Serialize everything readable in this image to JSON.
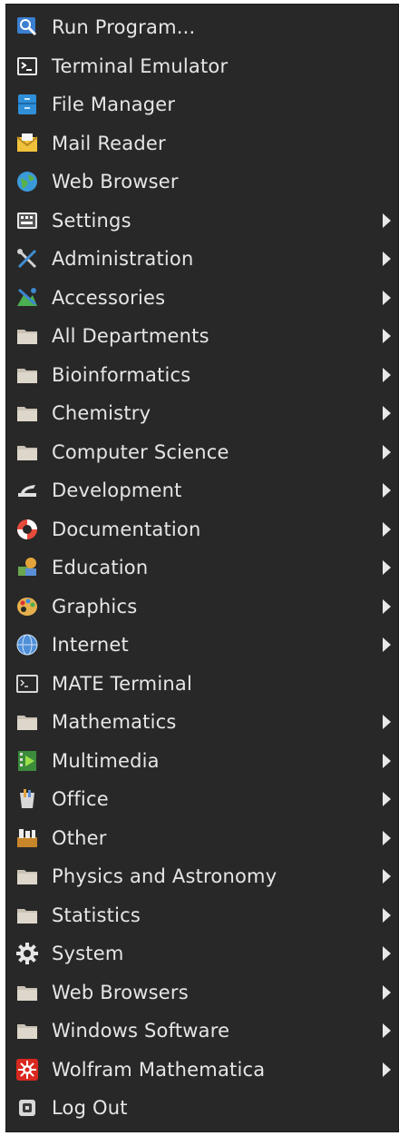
{
  "menu": {
    "items": [
      {
        "label": "Run Program...",
        "icon": "run-program-icon",
        "submenu": false
      },
      {
        "label": "Terminal Emulator",
        "icon": "terminal-icon",
        "submenu": false
      },
      {
        "label": "File Manager",
        "icon": "file-manager-icon",
        "submenu": false
      },
      {
        "label": "Mail Reader",
        "icon": "mail-icon",
        "submenu": false
      },
      {
        "label": "Web Browser",
        "icon": "globe-icon",
        "submenu": false
      },
      {
        "label": "Settings",
        "icon": "settings-icon",
        "submenu": true
      },
      {
        "label": "Administration",
        "icon": "tools-icon",
        "submenu": true
      },
      {
        "label": "Accessories",
        "icon": "accessories-icon",
        "submenu": true
      },
      {
        "label": "All Departments",
        "icon": "folder-icon",
        "submenu": true
      },
      {
        "label": "Bioinformatics",
        "icon": "folder-icon",
        "submenu": true
      },
      {
        "label": "Chemistry",
        "icon": "folder-icon",
        "submenu": true
      },
      {
        "label": "Computer Science",
        "icon": "folder-icon",
        "submenu": true
      },
      {
        "label": "Development",
        "icon": "development-icon",
        "submenu": true
      },
      {
        "label": "Documentation",
        "icon": "lifebuoy-icon",
        "submenu": true
      },
      {
        "label": "Education",
        "icon": "education-icon",
        "submenu": true
      },
      {
        "label": "Graphics",
        "icon": "palette-icon",
        "submenu": true
      },
      {
        "label": "Internet",
        "icon": "internet-icon",
        "submenu": true
      },
      {
        "label": "MATE Terminal",
        "icon": "mate-terminal-icon",
        "submenu": false
      },
      {
        "label": "Mathematics",
        "icon": "folder-icon",
        "submenu": true
      },
      {
        "label": "Multimedia",
        "icon": "multimedia-icon",
        "submenu": true
      },
      {
        "label": "Office",
        "icon": "office-icon",
        "submenu": true
      },
      {
        "label": "Other",
        "icon": "other-icon",
        "submenu": true
      },
      {
        "label": "Physics and Astronomy",
        "icon": "folder-icon",
        "submenu": true
      },
      {
        "label": "Statistics",
        "icon": "folder-icon",
        "submenu": true
      },
      {
        "label": "System",
        "icon": "gear-icon",
        "submenu": true
      },
      {
        "label": "Web Browsers",
        "icon": "folder-icon",
        "submenu": true
      },
      {
        "label": "Windows Software",
        "icon": "folder-icon",
        "submenu": true
      },
      {
        "label": "Wolfram Mathematica",
        "icon": "wolfram-icon",
        "submenu": true
      },
      {
        "label": "Log Out",
        "icon": "logout-icon",
        "submenu": false
      }
    ]
  },
  "colors": {
    "background": "#282828",
    "text": "#e6e6e6",
    "arrow": "#e8e8e8"
  }
}
